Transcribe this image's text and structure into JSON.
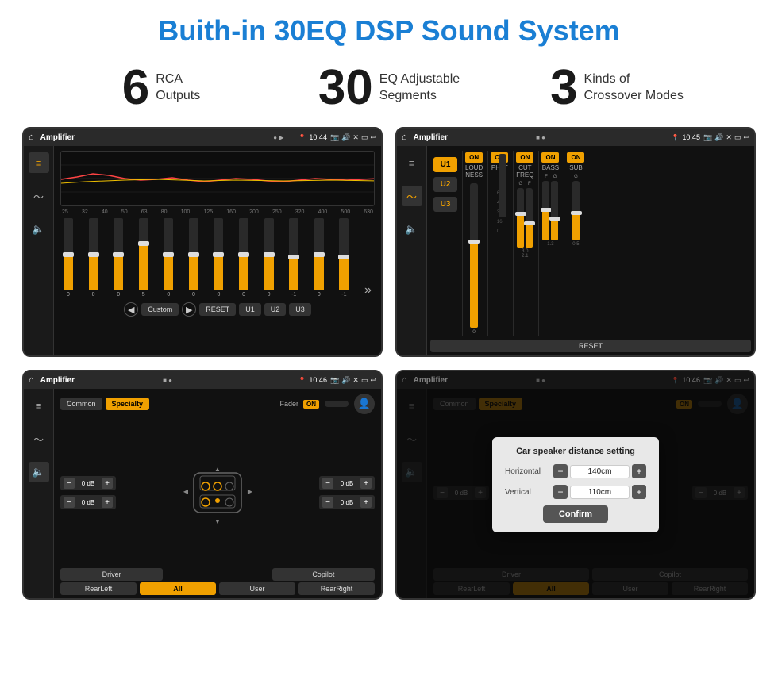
{
  "page": {
    "title": "Buith-in 30EQ DSP Sound System",
    "stats": [
      {
        "number": "6",
        "text": "RCA\nOutputs"
      },
      {
        "number": "30",
        "text": "EQ Adjustable\nSegments"
      },
      {
        "number": "3",
        "text": "Kinds of\nCrossover Modes"
      }
    ]
  },
  "screen1": {
    "title": "Amplifier",
    "time": "10:44",
    "freq_labels": [
      "25",
      "32",
      "40",
      "50",
      "63",
      "80",
      "100",
      "125",
      "160",
      "200",
      "250",
      "320",
      "400",
      "500",
      "630"
    ],
    "slider_values": [
      "0",
      "0",
      "0",
      "5",
      "0",
      "0",
      "0",
      "0",
      "0",
      "-1",
      "0",
      "-1"
    ],
    "eq_mode": "Custom",
    "buttons": [
      "Custom",
      "RESET",
      "U1",
      "U2",
      "U3"
    ]
  },
  "screen2": {
    "title": "Amplifier",
    "time": "10:45",
    "u_buttons": [
      "U1",
      "U2",
      "U3"
    ],
    "channels": [
      "LOUDNESS",
      "PHAT",
      "CUT FREQ",
      "BASS",
      "SUB"
    ],
    "freq_values": [
      "3.0",
      "2.1",
      "1.3",
      "0.5"
    ],
    "reset_label": "RESET"
  },
  "screen3": {
    "title": "Amplifier",
    "time": "10:46",
    "tabs": [
      "Common",
      "Specialty"
    ],
    "fader_label": "Fader",
    "on_label": "ON",
    "db_values": [
      "0 dB",
      "0 dB",
      "0 dB",
      "0 dB"
    ],
    "bottom_buttons": [
      "Driver",
      "",
      "Copilot",
      "RearLeft",
      "All",
      "User",
      "RearRight"
    ]
  },
  "screen4": {
    "title": "Amplifier",
    "time": "10:46",
    "tabs": [
      "Common",
      "Specialty"
    ],
    "on_label": "ON",
    "dialog": {
      "title": "Car speaker distance setting",
      "fields": [
        {
          "label": "Horizontal",
          "value": "140cm"
        },
        {
          "label": "Vertical",
          "value": "110cm"
        }
      ],
      "confirm_label": "Confirm"
    },
    "db_values": [
      "0 dB",
      "0 dB"
    ],
    "bottom_buttons": [
      "Driver",
      "Copilot",
      "RearLeft",
      "All",
      "User",
      "RearRight"
    ]
  }
}
